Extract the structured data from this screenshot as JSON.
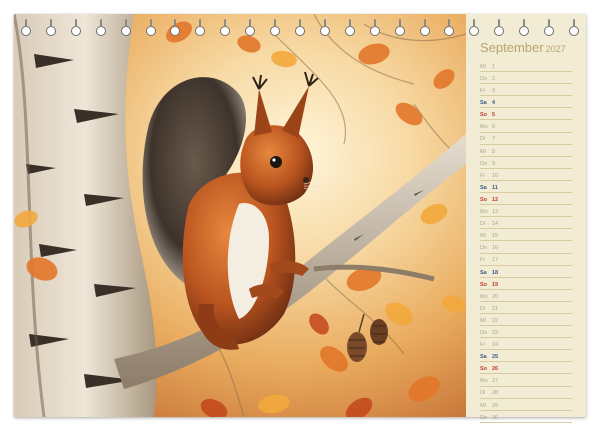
{
  "calendar": {
    "month": "September",
    "year": "2027",
    "days": [
      {
        "abbr": "Mi",
        "num": "1",
        "kind": "weekday"
      },
      {
        "abbr": "Do",
        "num": "2",
        "kind": "weekday"
      },
      {
        "abbr": "Fr",
        "num": "3",
        "kind": "weekday"
      },
      {
        "abbr": "Sa",
        "num": "4",
        "kind": "saturday"
      },
      {
        "abbr": "So",
        "num": "5",
        "kind": "sunday"
      },
      {
        "abbr": "Mo",
        "num": "6",
        "kind": "weekday"
      },
      {
        "abbr": "Di",
        "num": "7",
        "kind": "weekday"
      },
      {
        "abbr": "Mi",
        "num": "8",
        "kind": "weekday"
      },
      {
        "abbr": "Do",
        "num": "9",
        "kind": "weekday"
      },
      {
        "abbr": "Fr",
        "num": "10",
        "kind": "weekday"
      },
      {
        "abbr": "Sa",
        "num": "11",
        "kind": "saturday"
      },
      {
        "abbr": "So",
        "num": "12",
        "kind": "sunday"
      },
      {
        "abbr": "Mo",
        "num": "13",
        "kind": "weekday"
      },
      {
        "abbr": "Di",
        "num": "14",
        "kind": "weekday"
      },
      {
        "abbr": "Mi",
        "num": "15",
        "kind": "weekday"
      },
      {
        "abbr": "Do",
        "num": "16",
        "kind": "weekday"
      },
      {
        "abbr": "Fr",
        "num": "17",
        "kind": "weekday"
      },
      {
        "abbr": "Sa",
        "num": "18",
        "kind": "saturday"
      },
      {
        "abbr": "So",
        "num": "19",
        "kind": "sunday"
      },
      {
        "abbr": "Mo",
        "num": "20",
        "kind": "weekday"
      },
      {
        "abbr": "Di",
        "num": "21",
        "kind": "weekday"
      },
      {
        "abbr": "Mi",
        "num": "22",
        "kind": "weekday"
      },
      {
        "abbr": "Do",
        "num": "23",
        "kind": "weekday"
      },
      {
        "abbr": "Fr",
        "num": "24",
        "kind": "weekday"
      },
      {
        "abbr": "Sa",
        "num": "25",
        "kind": "saturday"
      },
      {
        "abbr": "So",
        "num": "26",
        "kind": "sunday"
      },
      {
        "abbr": "Mo",
        "num": "27",
        "kind": "weekday"
      },
      {
        "abbr": "Di",
        "num": "28",
        "kind": "weekday"
      },
      {
        "abbr": "Mi",
        "num": "29",
        "kind": "weekday"
      },
      {
        "abbr": "Do",
        "num": "30",
        "kind": "weekday"
      }
    ]
  },
  "illustration": {
    "subject": "red squirrel on a birch branch with autumn leaves",
    "icons": [
      "squirrel-illustration",
      "birch-trunk",
      "branch",
      "autumn-leaf",
      "pine-cone"
    ]
  },
  "binding": {
    "ring_count": 23
  },
  "colors": {
    "panel_bg": "#f3ecd4",
    "title": "#b7a66a",
    "weekday": "#a9a68a",
    "saturday": "#3a5a88",
    "sunday": "#c23a2e",
    "rule": "#d8cc9e"
  }
}
